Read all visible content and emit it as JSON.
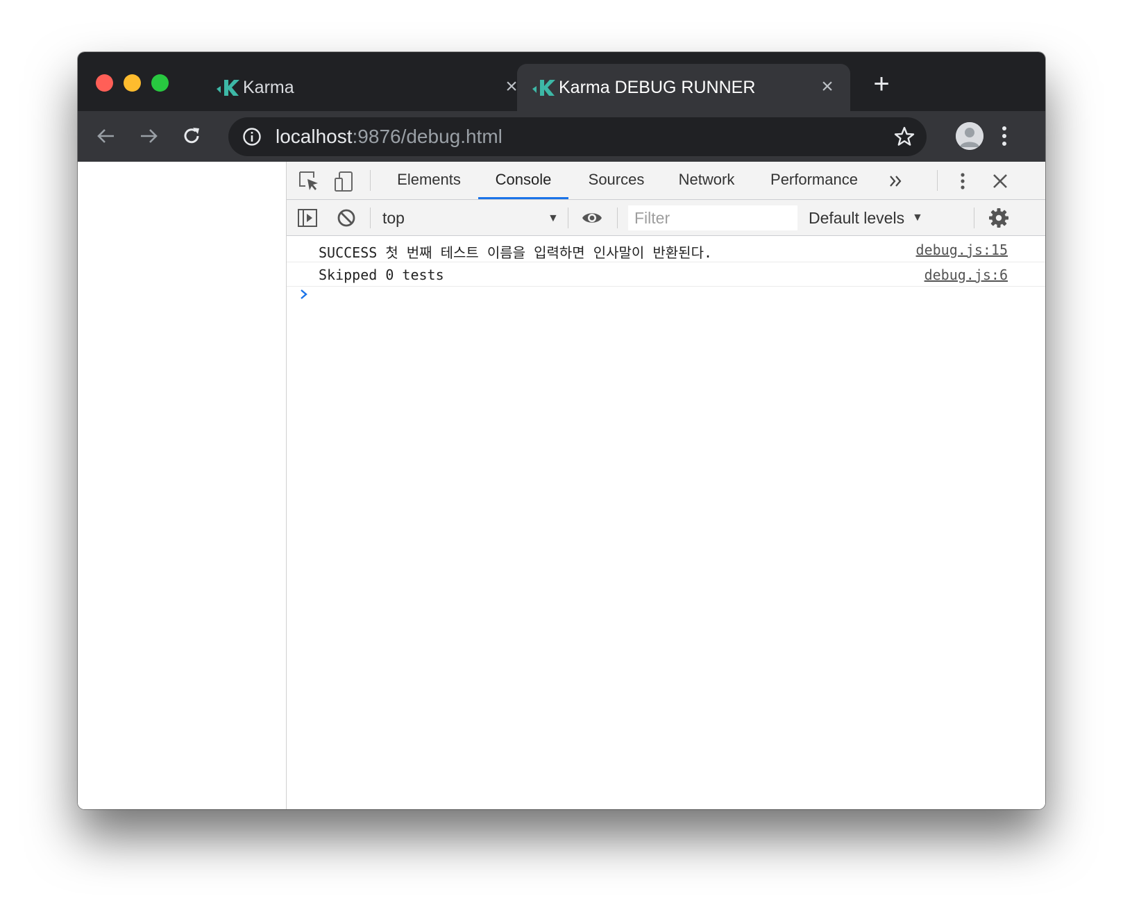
{
  "browser": {
    "tabs": [
      {
        "title": "Karma",
        "active": false
      },
      {
        "title": "Karma DEBUG RUNNER",
        "active": true
      }
    ],
    "address": {
      "host": "localhost",
      "rest": ":9876/debug.html"
    }
  },
  "devtools": {
    "tabs": [
      "Elements",
      "Console",
      "Sources",
      "Network",
      "Performance"
    ],
    "active_tab": "Console",
    "console_toolbar": {
      "context": "top",
      "filter_placeholder": "Filter",
      "levels": "Default levels"
    },
    "messages": [
      {
        "text": "SUCCESS 첫 번째 테스트 이름을 입력하면 인사말이 반환된다.",
        "source": "debug.js:15"
      },
      {
        "text": "Skipped 0 tests",
        "source": "debug.js:6"
      }
    ]
  },
  "colors": {
    "accent": "#1a73e8",
    "karma_logo": "#3db8a6",
    "tabstrip": "#202124",
    "toolbar": "#35363a"
  }
}
